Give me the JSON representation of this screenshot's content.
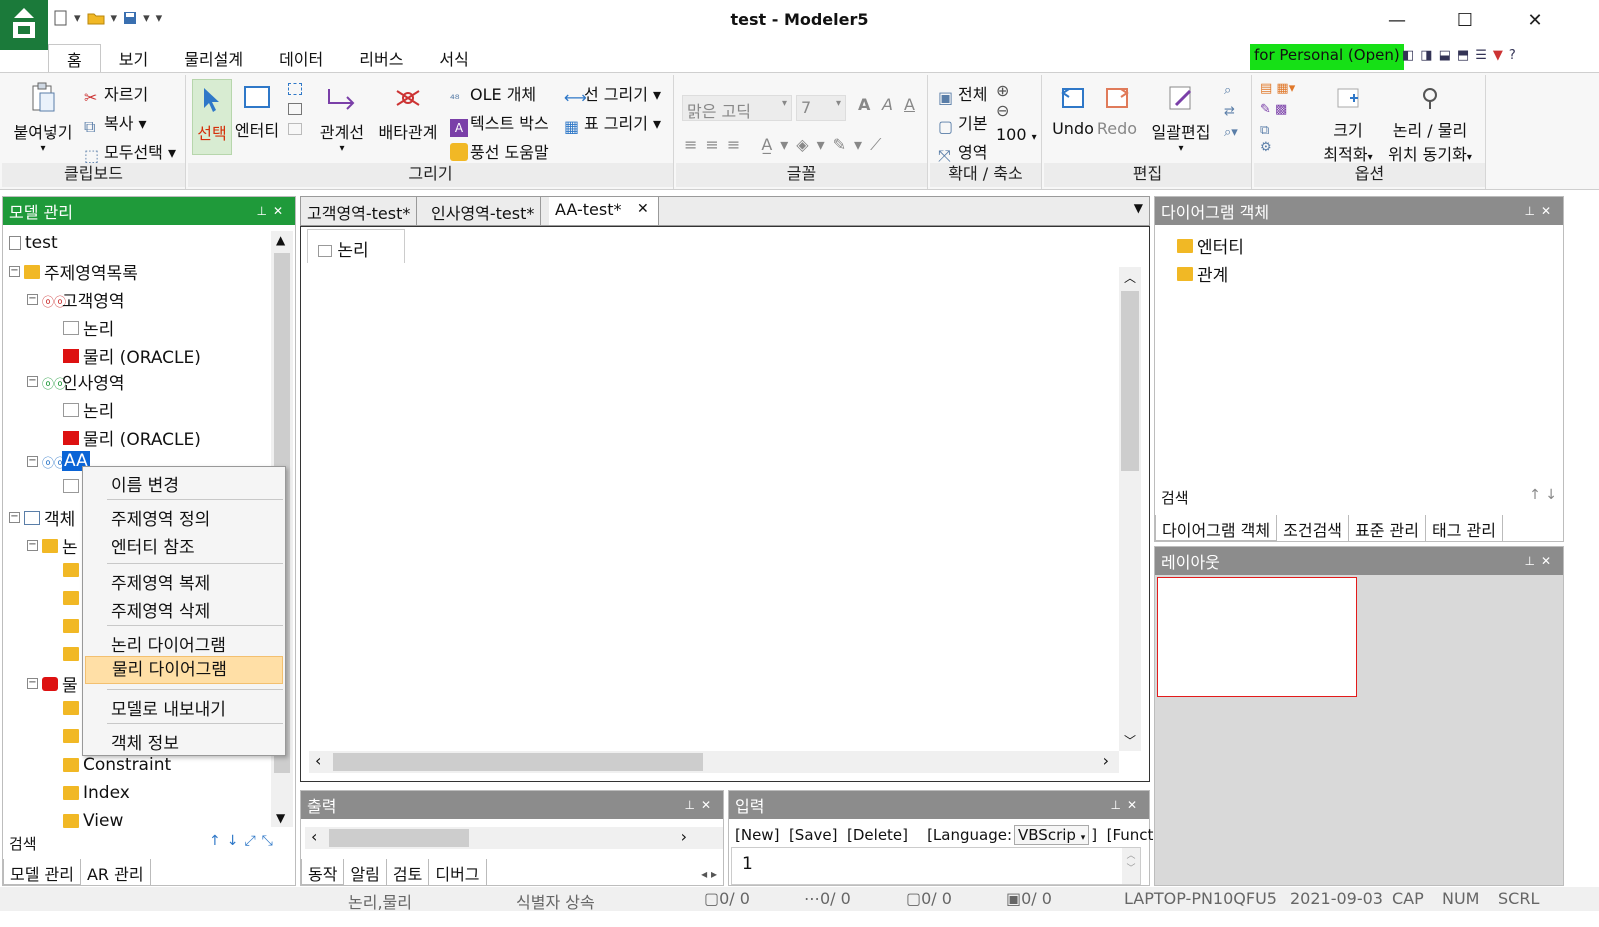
{
  "window": {
    "title": "test - Modeler5",
    "controls": {
      "minimize": "—",
      "maximize": "☐",
      "close": "✕"
    }
  },
  "quick_access": [
    "new-doc-icon",
    "open-folder-icon",
    "save-icon"
  ],
  "ribbon": {
    "tabs": [
      "홈",
      "보기",
      "물리설계",
      "데이터",
      "리버스",
      "서식"
    ],
    "active_tab": "홈",
    "badge": "for Personal (Open)",
    "help": "?",
    "groups": {
      "clipboard": {
        "label": "클립보드",
        "paste": "붙여넣기",
        "cut": "자르기",
        "copy": "복사",
        "select_all": "모두선택"
      },
      "draw": {
        "label": "그리기",
        "select": "선택",
        "entity": "엔터티",
        "relation": "관계선",
        "exclusive": "배타관계",
        "ole": "OLE 개체",
        "textbox": "텍스트 박스",
        "balloon": "풍선 도움말",
        "line": "선 그리기",
        "table": "표 그리기"
      },
      "font": {
        "label": "글꼴",
        "font_name": "맑은 고딕",
        "font_size": "7",
        "style_buttons": [
          "A",
          "A",
          "A"
        ]
      },
      "zoom": {
        "label": "확대 / 축소",
        "all": "전체",
        "default": "기본",
        "area": "영역",
        "value": "100"
      },
      "edit": {
        "label": "편집",
        "undo": "Undo",
        "redo": "Redo",
        "batch_edit": "일괄편집"
      },
      "options": {
        "label": "옵션",
        "size_line1": "크기",
        "size_line2": "최적화",
        "sync_line1": "논리 / 물리",
        "sync_line2": "위치 동기화"
      }
    }
  },
  "left_panel": {
    "title": "모델 관리",
    "tree": {
      "root": "test",
      "subject_list": "주제영역목록",
      "customer": "고객영역",
      "logical": "논리",
      "physical": "물리 (ORACLE)",
      "hr": "인사영역",
      "aa": "AA",
      "objects": "객체",
      "obj_logical": "논",
      "obj_physical": "물",
      "constraint": "Constraint",
      "index": "Index",
      "view": "View"
    },
    "search_label": "검색",
    "tabs": [
      "모델 관리",
      "AR 관리"
    ]
  },
  "context_menu": {
    "items": [
      "이름 변경",
      "주제영역 정의",
      "엔터티 참조",
      "주제영역 복제",
      "주제영역 삭제",
      "논리 다이어그램",
      "물리 다이어그램",
      "모델로 내보내기",
      "객체 정보"
    ],
    "highlighted": "물리 다이어그램"
  },
  "document": {
    "tabs": [
      "고객영역-test*",
      "인사영역-test*",
      "AA-test*"
    ],
    "active_tab": "AA-test*",
    "close": "✕",
    "subtab": "논리"
  },
  "output_panel": {
    "title": "출력",
    "tabs": [
      "동작",
      "알림",
      "검토",
      "디버그"
    ]
  },
  "input_panel": {
    "title": "입력",
    "toolbar": "[New]  [Save]  [Delete]    [Language:",
    "language": "VBScrip",
    "toolbar_tail": "]  [Funct",
    "line_no": "1"
  },
  "diagram_panel": {
    "title": "다이어그램 객체",
    "items": [
      "엔터티",
      "관계"
    ],
    "search_label": "검색",
    "tabs": [
      "다이어그램 객체",
      "조건검색",
      "표준 관리",
      "태그 관리"
    ]
  },
  "layout_panel": {
    "title": "레이아웃"
  },
  "status_bar": {
    "mode": "논리,물리",
    "inherit": "식별자 상속",
    "count1": "0/   0",
    "count2": "0/   0",
    "count3": "0/   0",
    "count4": "0/   0",
    "machine": "LAPTOP-PN10QFU5",
    "date": "2021-09-03",
    "caps": "CAP",
    "num": "NUM",
    "scrl": "SCRL"
  },
  "colors": {
    "accent_green": "#1f9a3a",
    "badge_green": "#16e016",
    "selection_blue": "#0a64d6",
    "menu_highlight": "#ffdfa6",
    "layout_border": "#e31b1b"
  }
}
